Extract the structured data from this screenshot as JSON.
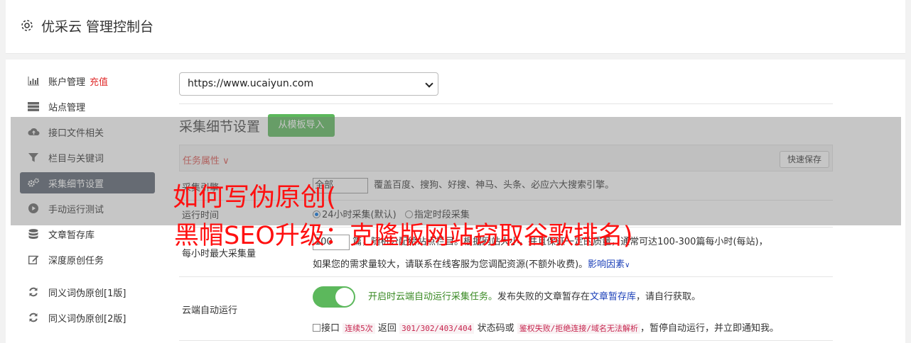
{
  "header": {
    "title": "优采云 管理控制台"
  },
  "sidebar": {
    "items": [
      {
        "label": "账户管理",
        "extra": "充值",
        "icon": "bar-chart-icon"
      },
      {
        "label": "站点管理",
        "icon": "server-icon"
      },
      {
        "label": "接口文件相关",
        "icon": "cloud-upload-icon"
      },
      {
        "label": "栏目与关键词",
        "icon": "filter-icon"
      },
      {
        "label": "采集细节设置",
        "icon": "gears-icon",
        "active": true
      },
      {
        "label": "手动运行测试",
        "icon": "play-circle-icon"
      },
      {
        "label": "文章暂存库",
        "icon": "database-icon"
      },
      {
        "label": "深度原创任务",
        "icon": "edit-icon"
      },
      {
        "label": "同义词伪原创[1版]",
        "icon": "refresh-icon"
      },
      {
        "label": "同义词伪原创[2版]",
        "icon": "refresh-icon"
      }
    ]
  },
  "site_select": {
    "value": "https://www.ucaiyun.com"
  },
  "section": {
    "title": "采集细节设置",
    "import_button": "从模板导入"
  },
  "table": {
    "attr_label": "任务属性",
    "quick_save": "快速保存",
    "row1": {
      "label": "采集引擎",
      "select_value": "全部",
      "desc": "覆盖百度、搜狗、好搜、神马、头条、必应六大搜索引擎。"
    },
    "row2": {
      "label": "运行时间",
      "opt1": "24小时采集(默认)",
      "opt2": "指定时段采集"
    },
    "row3": {
      "label": "每小时最大采集量",
      "value": "100",
      "text1": "篇，随机分配给站点栏目。根据网站大小，并且保证一定的质量，通常可达100-300篇每小时(每站)，",
      "text2": "如果您的需求量较大，请联系在线客服为您调配资源(不额外收费)。",
      "link": "影响因素"
    },
    "row4": {
      "label": "云端自动运行",
      "green_text": "开启时云端自动运行采集任务。",
      "text_a": "发布失败的文章暂存在",
      "link": "文章暂存库",
      "text_b": "，请自行获取。",
      "chk_label": "接口",
      "code1": "连续5次",
      "text_c": "返回",
      "code2": "301/302/403/404",
      "text_d": "状态码或",
      "code3": "鉴权失败/拒绝连接/域名无法解析",
      "text_e": "，暂停自动运行，并立即通知我。"
    }
  },
  "watermark": {
    "line1": "如何写伪原创(",
    "line2": "黑帽SEO升级：克隆版网站窃取谷歌排名)"
  }
}
